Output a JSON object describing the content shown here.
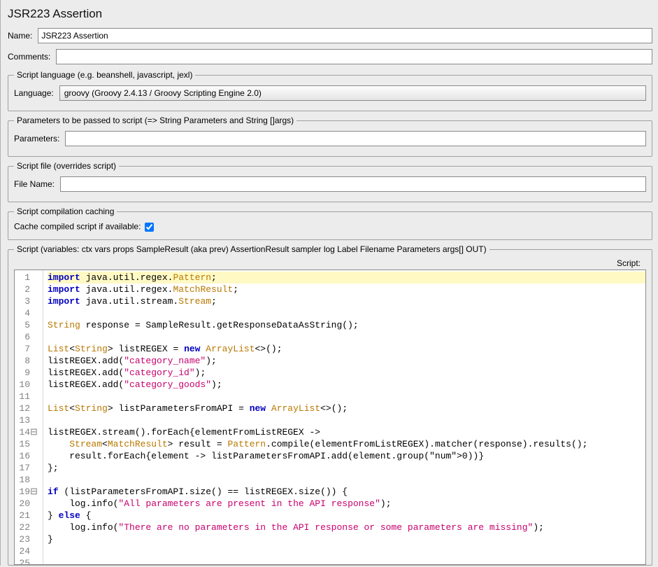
{
  "title": "JSR223 Assertion",
  "name": {
    "label": "Name:",
    "value": "JSR223 Assertion"
  },
  "comments": {
    "label": "Comments:",
    "value": ""
  },
  "lang": {
    "legend": "Script language (e.g. beanshell, javascript, jexl)",
    "label": "Language:",
    "value": "groovy     (Groovy 2.4.13 / Groovy Scripting Engine 2.0)"
  },
  "params": {
    "legend": "Parameters to be passed to script (=> String Parameters and String []args)",
    "label": "Parameters:",
    "value": ""
  },
  "file": {
    "legend": "Script file (overrides script)",
    "label": "File Name:",
    "value": ""
  },
  "cache": {
    "legend": "Script compilation caching",
    "label": "Cache compiled script if available:",
    "checked": true
  },
  "script": {
    "legend": "Script (variables: ctx vars props SampleResult (aka prev) AssertionResult sampler log Label Filename Parameters args[] OUT)",
    "label": "Script:",
    "lines": 25,
    "code_plain": "import java.util.regex.Pattern;\nimport java.util.regex.MatchResult;\nimport java.util.stream.Stream;\n\nString response = SampleResult.getResponseDataAsString();\n\nList<String> listREGEX = new ArrayList<>();\nlistREGEX.add(\"category_name\");\nlistREGEX.add(\"category_id\");\nlistREGEX.add(\"category_goods\");\n\nList<String> listParametersFromAPI = new ArrayList<>();\n\nlistREGEX.stream().forEach{elementFromListREGEX ->\n    Stream<MatchResult> result = Pattern.compile(elementFromListREGEX).matcher(response).results();\n    result.forEach{element -> listParametersFromAPI.add(element.group(0))}\n};\n\nif (listParametersFromAPI.size() == listREGEX.size()) {\n    log.info(\"All parameters are present in the API response\");\n} else {\n    log.info(\"There are no parameters in the API response or some parameters are missing\");\n}\n\n"
  }
}
